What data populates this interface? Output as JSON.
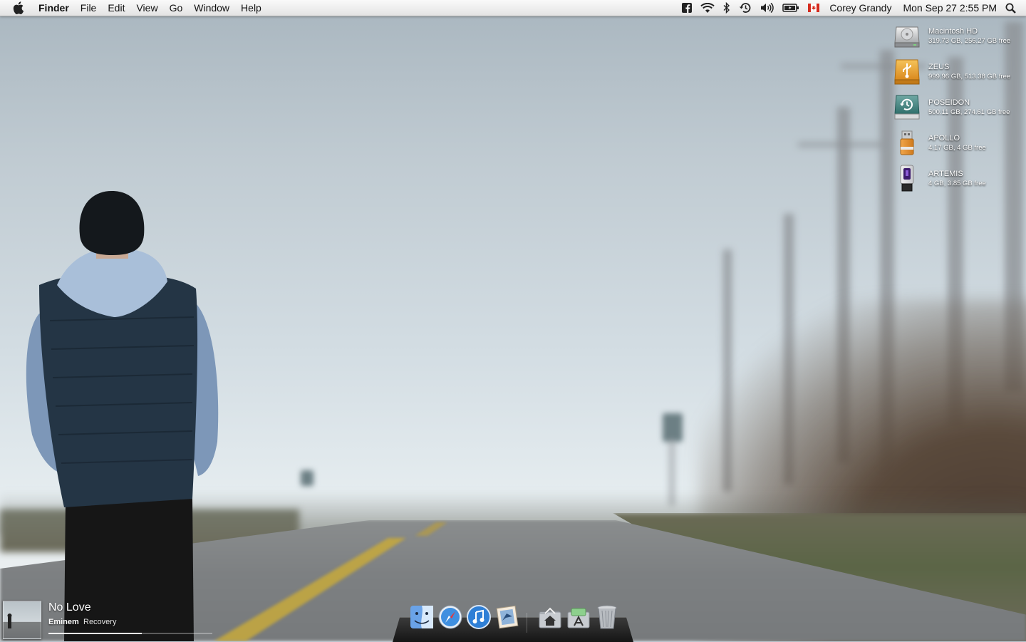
{
  "menubar": {
    "apple_icon": "apple-icon",
    "app_name": "Finder",
    "menus": [
      "File",
      "Edit",
      "View",
      "Go",
      "Window",
      "Help"
    ],
    "status_icons": [
      "facebook-icon",
      "wifi-icon",
      "bluetooth-icon",
      "time-machine-icon",
      "volume-icon",
      "battery-icon",
      "canada-flag-icon"
    ],
    "user_name": "Corey Grandy",
    "clock": "Mon Sep 27  2:55 PM",
    "spotlight_icon": "spotlight-icon"
  },
  "drives": [
    {
      "name": "Macintosh HD",
      "info": "319.73 GB, 256.27 GB free",
      "icon": "internal-hard-drive-icon"
    },
    {
      "name": "ZEUS",
      "info": "999.96 GB, 513.38 GB free",
      "icon": "usb-external-drive-icon"
    },
    {
      "name": "POSEIDON",
      "info": "500.11 GB, 274.61 GB free",
      "icon": "time-machine-drive-icon"
    },
    {
      "name": "APOLLO",
      "info": "4.17 GB, 4 GB free",
      "icon": "usb-flash-drive-icon"
    },
    {
      "name": "ARTEMIS",
      "info": "4 GB, 3.85 GB free",
      "icon": "usb-flash-drive-purple-icon"
    }
  ],
  "now_playing": {
    "track": "No Love",
    "artist": "Eminem",
    "album": "Recovery",
    "progress": 0.57
  },
  "dock": {
    "apps": [
      "finder-icon",
      "safari-icon",
      "itunes-icon",
      "mail-icon"
    ],
    "stacks": [
      "home-folder-icon",
      "applications-folder-icon",
      "trash-icon"
    ]
  },
  "colors": {
    "menubar_bg": "#e9e9e9",
    "desktop_text": "#ffffff",
    "dock_shelf": "#1e1e1e"
  }
}
